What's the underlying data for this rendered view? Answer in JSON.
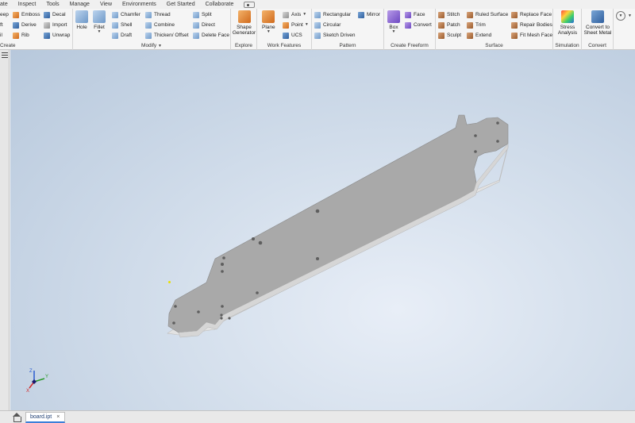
{
  "menu_tabs": [
    "ate",
    "Inspect",
    "Tools",
    "Manage",
    "View",
    "Environments",
    "Get Started",
    "Collaborate"
  ],
  "ribbon": {
    "create": {
      "title": "Create",
      "items": [
        "eep",
        "ft",
        "il"
      ],
      "items2": [
        "Emboss",
        "Derive",
        "Rib"
      ],
      "items3": [
        "Decal",
        "Import",
        "Unwrap"
      ]
    },
    "modify": {
      "title": "Modify",
      "hole": "Hole",
      "fillet": "Fillet",
      "col1": [
        "Chamfer",
        "Shell",
        "Draft"
      ],
      "col2": [
        "Thread",
        "Combine",
        "Thicken/ Offset"
      ],
      "col3": [
        "Split",
        "Direct",
        "Delete Face"
      ]
    },
    "explore": {
      "title": "Explore",
      "shape_generator": "Shape Generator"
    },
    "work_features": {
      "title": "Work Features",
      "plane": "Plane",
      "items": [
        "Axis",
        "Point",
        "UCS"
      ]
    },
    "pattern": {
      "title": "Pattern",
      "items": [
        "Rectangular",
        "Circular",
        "Sketch Driven"
      ],
      "mirror": "Mirror"
    },
    "freeform": {
      "title": "Create Freeform",
      "box": "Box",
      "items": [
        "Face",
        "Convert"
      ]
    },
    "surface": {
      "title": "Surface",
      "col1": [
        "Stitch",
        "Patch",
        "Sculpt"
      ],
      "col2": [
        "Ruled Surface",
        "Trim",
        "Extend"
      ],
      "col3": [
        "Replace Face",
        "Repair Bodies",
        "Fit Mesh Face"
      ]
    },
    "simulation": {
      "title": "Simulation",
      "stress_analysis": "Stress Analysis"
    },
    "convert": {
      "title": "Convert",
      "convert_sheet_metal": "Convert to Sheet Metal"
    }
  },
  "triad": {
    "x": "X",
    "y": "Y",
    "z": "Z"
  },
  "document_tab": {
    "label": "board.ipt",
    "close": "×"
  },
  "colors": {
    "accent": "#3c7fd8",
    "viewport_bg": "#d4dfec",
    "part_face": "#a9a9a9",
    "part_edge": "#d6d6d6"
  }
}
